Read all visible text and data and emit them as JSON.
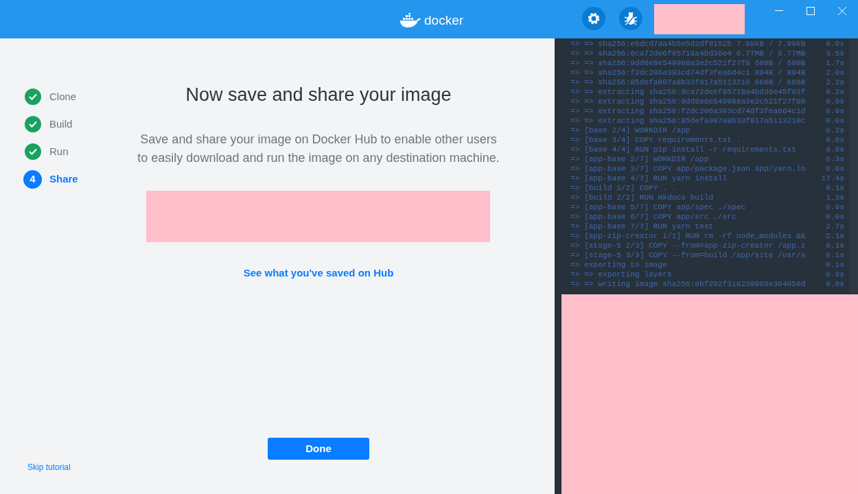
{
  "header": {
    "logo_text": "docker"
  },
  "steps": [
    {
      "label": "Clone",
      "done": true,
      "selected": false
    },
    {
      "label": "Build",
      "done": true,
      "selected": false
    },
    {
      "label": "Run",
      "done": true,
      "selected": false
    },
    {
      "label": "Share",
      "number": "4",
      "done": false,
      "selected": true
    }
  ],
  "title": "Now save and share your image",
  "description": "Save and share your image on Docker Hub to enable other users to easily download and run the image on any destination machine.",
  "hub_link": "See what you've saved on Hub",
  "done_button": "Done",
  "skip_link": "Skip tutorial",
  "terminal": [
    {
      "text": "=> => sha256:e5dcd7aa4b5e5d2df8152b 7.99kB / 7.99kB",
      "time": "0.0s"
    },
    {
      "text": "=> => sha256:0ca72de6f95718a4bd36e4 6.77MB / 6.77MB",
      "time": "3.5s"
    },
    {
      "text": "=> => sha256:9dd8e8e549988a3e2c521f27f8 600B / 600B",
      "time": "1.7s"
    },
    {
      "text": "=> => sha256:f2dc206a393cd74df3fea6d4c1 894B / 894B",
      "time": "2.0s"
    },
    {
      "text": "=> => sha256:85defa007a8b33f817a5113210 666B / 666B",
      "time": "2.2s"
    },
    {
      "text": "=> => extracting sha256:0ca72de6f95718a4bd36e45f03f",
      "time": "0.2s"
    },
    {
      "text": "=> => extracting sha256:9dd8e8e549988a3e2c521f27f80",
      "time": "0.0s"
    },
    {
      "text": "=> => extracting sha256:f2dc206a393cd74df3fea6d4c1d",
      "time": "0.0s"
    },
    {
      "text": "=> => extracting sha256:85defa007a8b33f817a5113210c",
      "time": "0.0s"
    },
    {
      "text": "=> [base 2/4] WORKDIR /app",
      "time": "0.2s"
    },
    {
      "text": "=> [base 3/4] COPY requirements.txt .",
      "time": "0.0s"
    },
    {
      "text": "=> [base 4/4] RUN pip install -r requirements.txt",
      "time": "9.8s"
    },
    {
      "text": "=> [app-base 2/7] WORKDIR /app",
      "time": "0.3s"
    },
    {
      "text": "=> [app-base 3/7] COPY app/package.json app/yarn.lo",
      "time": "0.0s"
    },
    {
      "text": "=> [app-base 4/7] RUN yarn install",
      "time": "17.4s"
    },
    {
      "text": "=> [build 1/2] COPY . .",
      "time": "0.1s"
    },
    {
      "text": "=> [build 2/2] RUN mkdocs build",
      "time": "1.3s"
    },
    {
      "text": "=> [app-base 5/7] COPY app/spec ./spec",
      "time": "0.0s"
    },
    {
      "text": "=> [app-base 6/7] COPY app/src ./src",
      "time": "0.0s"
    },
    {
      "text": "=> [app-base 7/7] RUN yarn test",
      "time": "2.7s"
    },
    {
      "text": "=> [app-zip-creator 1/1] RUN rm -rf node_modules &&",
      "time": "2.1s"
    },
    {
      "text": "=> [stage-5 2/3] COPY --from=app-zip-creator /app.z",
      "time": "0.1s"
    },
    {
      "text": "=> [stage-5 3/3] COPY --from=build /app/site /usr/s",
      "time": "0.1s"
    },
    {
      "text": "=> exporting to image",
      "time": "0.1s"
    },
    {
      "text": "=> => exporting layers",
      "time": "0.0s"
    },
    {
      "text": "=> => writing image sha256:0bf202f318239905e364058d",
      "time": "0.0s"
    }
  ]
}
